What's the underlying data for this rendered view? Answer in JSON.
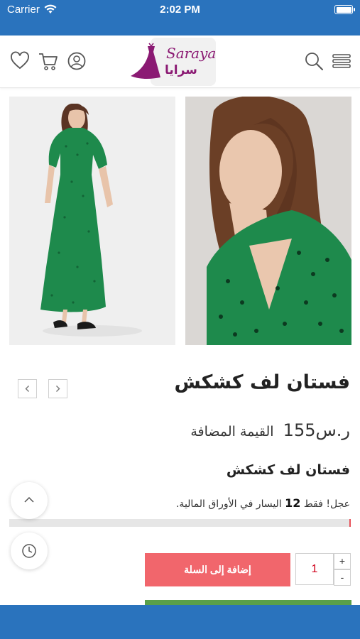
{
  "status_bar": {
    "carrier": "Carrier",
    "time": "2:02 PM"
  },
  "header": {
    "logo_latin": "Saraya",
    "logo_arabic": "سرايا",
    "icons": [
      "heart-icon",
      "cart-icon",
      "user-icon",
      "search-icon",
      "menu-icon"
    ]
  },
  "product": {
    "title": "فستان لف كشكش",
    "price_amount": "ر.س155",
    "price_vat": "القيمة المضافة",
    "subtitle": "فستان لف كشكش",
    "stock_prefix": "عجل! فقط",
    "stock_count": "12",
    "stock_suffix": "اليسار في الأوراق المالية.",
    "stock_fill_fraction": 0.005
  },
  "actions": {
    "add_to_cart_label": "إضافة إلى السلة",
    "quantity": "1",
    "plus_label": "+",
    "minus_label": "-"
  },
  "colors": {
    "brand_blue": "#2a73bd",
    "add_to_cart": "#f1666c",
    "accent_purple": "#8b1a73",
    "dress_green": "#1a8a4a"
  }
}
